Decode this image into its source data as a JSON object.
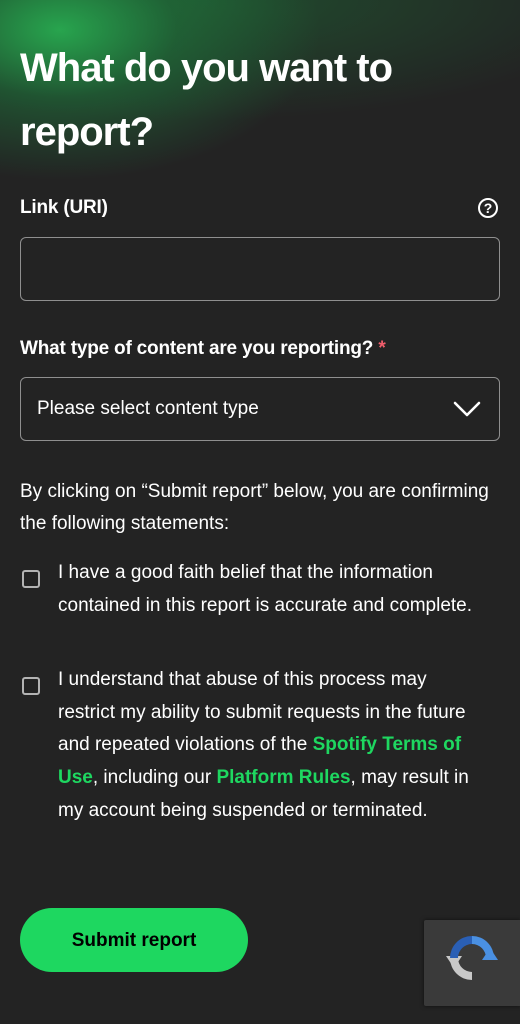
{
  "header": {
    "title": "What do you want to report?"
  },
  "link_field": {
    "label": "Link (URI)",
    "value": "",
    "placeholder": ""
  },
  "content_type": {
    "label": "What type of content are you reporting?",
    "required_marker": "*",
    "selected": "Please select content type"
  },
  "confirmation": {
    "intro": "By clicking on “Submit report” below, you are confirming the following statements:",
    "statement_1": "I have a good faith belief that the information contained in this report is accurate and complete.",
    "statement_2_part1": "I understand that abuse of this process may restrict my ability to submit requests in the future and repeated violations of the ",
    "terms_link": "Spotify Terms of Use",
    "statement_2_part2": ", including our ",
    "rules_link": "Platform Rules",
    "statement_2_part3": ", may result in my account being suspended or terminated."
  },
  "actions": {
    "submit_label": "Submit report"
  },
  "icons": {
    "help": "help-circle-icon",
    "dropdown": "chevron-down-icon",
    "recaptcha": "recaptcha-icon"
  },
  "colors": {
    "background": "#232323",
    "accent": "#1ed760",
    "required": "#f15e6c",
    "border": "#8f8f8f"
  }
}
